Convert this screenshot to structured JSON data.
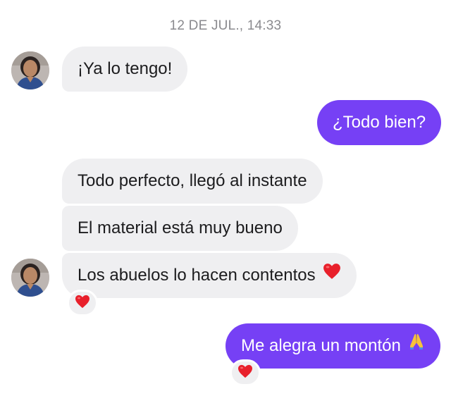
{
  "conversation": {
    "timestamp": "12 DE JUL., 14:33",
    "messages": [
      {
        "sender": "contact",
        "text": "¡Ya lo tengo!"
      },
      {
        "sender": "me",
        "text": "¿Todo bien?"
      },
      {
        "sender": "contact",
        "text": "Todo perfecto, llegó al instante"
      },
      {
        "sender": "contact",
        "text": "El material está muy bueno"
      },
      {
        "sender": "contact",
        "text": "Los abuelos lo hacen contentos",
        "trailing_emoji": "red-heart",
        "reaction": "red-heart"
      },
      {
        "sender": "me",
        "text": "Me alegra un montón",
        "trailing_emoji": "folded-hands",
        "reaction": "red-heart"
      }
    ]
  },
  "colors": {
    "outgoing_bubble": "#7640f5",
    "incoming_bubble": "#efeff1",
    "timestamp_text": "#8a8a8e",
    "heart": "#e8202b"
  }
}
